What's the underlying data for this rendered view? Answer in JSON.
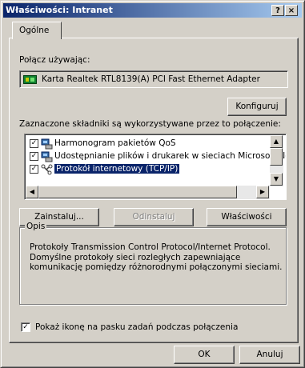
{
  "window": {
    "title": "Właściwości: Intranet",
    "help_label": "?",
    "close_label": "×"
  },
  "tabs": [
    {
      "label": "Ogólne",
      "active": true
    }
  ],
  "connect_using": {
    "label": "Połącz używając:",
    "adapter_name": "Karta Realtek RTL8139(A) PCI Fast Ethernet Adapter",
    "adapter_icon": "network-card-icon",
    "configure_button": "Konfiguruj"
  },
  "components": {
    "label": "Zaznaczone składniki są wykorzystywane przez to połączenie:",
    "items": [
      {
        "label": "Harmonogram pakietów QoS",
        "checked": true,
        "icon": "network-service-icon",
        "selected": false
      },
      {
        "label": "Udostępnianie plików i drukarek w sieciach Microsoft Ne",
        "checked": true,
        "icon": "network-service-icon",
        "selected": false
      },
      {
        "label": "Protokół internetowy (TCP/IP)",
        "checked": true,
        "icon": "protocol-icon",
        "selected": true
      }
    ]
  },
  "buttons": {
    "install": "Zainstaluj...",
    "uninstall": "Odinstaluj",
    "properties": "Właściwości"
  },
  "description": {
    "legend": "Opis",
    "text": "Protokoły Transmission Control Protocol/Internet Protocol. Domyślne protokoły sieci rozległych zapewniające komunikację pomiędzy różnorodnymi połączonymi sieciami."
  },
  "show_icon": {
    "label": "Pokaż ikonę na pasku zadań podczas połączenia",
    "checked": true
  },
  "footer": {
    "ok": "OK",
    "cancel": "Anuluj"
  },
  "colors": {
    "face": "#d4d0c8",
    "title_start": "#0a246a",
    "title_end": "#a6caf0",
    "selection": "#0a246a"
  }
}
